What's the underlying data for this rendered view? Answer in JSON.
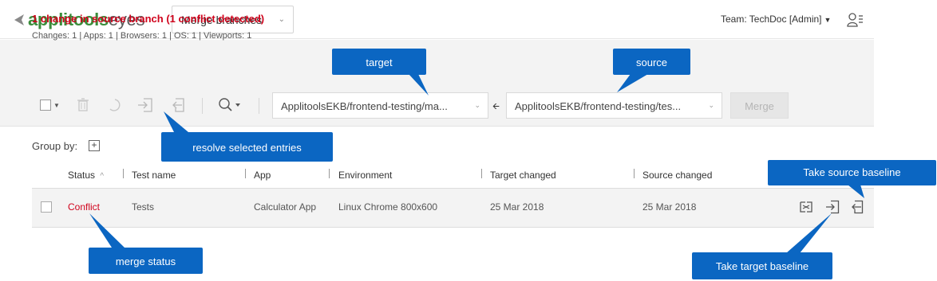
{
  "header": {
    "logo_part1": "applitools",
    "logo_part2": "eyes",
    "branch_selector": "Merge branches",
    "team": "Team: TechDoc [Admin]"
  },
  "panel": {
    "change_title": "1 change in source branch (1 conflict detected)",
    "stats": "Changes: 1 | Apps: 1 | Browsers: 1 | OS: 1 | Viewports: 1",
    "target_path": "ApplitoolsEKB/frontend-testing/ma...",
    "source_path": "ApplitoolsEKB/frontend-testing/tes...",
    "merge_label": "Merge"
  },
  "groupby": {
    "label": "Group by:",
    "plus": "+"
  },
  "table": {
    "columns": [
      "Status",
      "Test name",
      "App",
      "Environment",
      "Target changed",
      "Source changed"
    ],
    "sort_indicator": "^",
    "row": {
      "status": "Conflict",
      "test_name": "Tests",
      "app": "Calculator App",
      "environment": "Linux Chrome 800x600",
      "target_changed": "25 Mar 2018",
      "source_changed": "25 Mar 2018"
    }
  },
  "callouts": {
    "target": "target",
    "source": "source",
    "resolve": "resolve selected entries",
    "source_baseline": "Take source baseline",
    "merge_status": "merge status",
    "target_baseline": "Take target baseline"
  },
  "colors": {
    "callout": "#0b66c2",
    "conflict": "#d0021b",
    "panel_bg": "#f3f3f3"
  }
}
